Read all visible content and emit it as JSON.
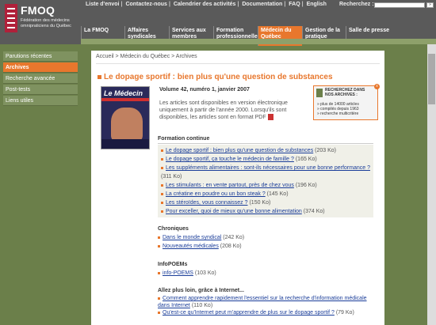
{
  "header": {
    "logo_text": "FMOQ",
    "logo_sub": "Fédération des médecins omnipraticiens du Québec",
    "top_links": [
      "Liste d'envoi",
      "Contactez-nous",
      "Calendrier des activités",
      "Documentation",
      "FAQ",
      "English"
    ],
    "search_label": "Recherchez :",
    "search_value": "",
    "search_go": "»"
  },
  "nav": {
    "items": [
      {
        "label": "La FMOQ",
        "active": false
      },
      {
        "label": "Affaires syndicales",
        "active": false
      },
      {
        "label": "Services aux membres",
        "active": false
      },
      {
        "label": "Formation professionnelle",
        "active": false
      },
      {
        "label": "Médecin du Québec",
        "active": true
      },
      {
        "label": "Gestion de la pratique",
        "active": false
      },
      {
        "label": "Salle de presse",
        "active": false
      }
    ]
  },
  "sidebar": {
    "items": [
      {
        "label": "Parutions récentes",
        "active": false
      },
      {
        "label": "Archives",
        "active": true
      },
      {
        "label": "Recherche avancée",
        "active": false
      },
      {
        "label": "Post-tests",
        "active": false
      },
      {
        "label": "Liens utiles",
        "active": false
      }
    ]
  },
  "breadcrumb": "Accueil > Médecin du Québec > Archives",
  "title": "Le dopage sportif : bien plus qu'une question de substances",
  "cover_title": "Le Médecin",
  "volume": "Volume 42, numéro 1, janvier 2007",
  "intro": "Les articles sont disponibles en version électronique uniquement à partir de l'année 2000. Lorsqu'ils sont disponibles, les articles sont en format PDF",
  "search_box": {
    "heading": "RECHERCHEZ DANS NOS ARCHIVES :",
    "close": "x",
    "points": [
      "» plus de 14000 articles",
      "» compilés depuis 1963",
      "» recherche multicritère"
    ]
  },
  "sections": {
    "formation": {
      "heading": "Formation continue",
      "items": [
        {
          "link": "Le dopage sportif : bien plus qu'une question de substances",
          "size": "(203 Ko)"
        },
        {
          "link": "Le dopage sportif, ça touche le médecin de famille ?",
          "size": "(165 Ko)"
        },
        {
          "link": "Les suppléments alimentaires : sont-ils nécessaires pour une bonne performance ?",
          "size": "(311 Ko)"
        },
        {
          "link": "Les stimulants : en vente partout, près de chez vous",
          "size": "(196 Ko)"
        },
        {
          "link": "La créatine en poudre ou un bon steak ?",
          "size": "(145 Ko)"
        },
        {
          "link": "Les stéroïdes, vous connaissez ?",
          "size": "(150 Ko)"
        },
        {
          "link": "Pour exceller, quoi de mieux qu'une bonne alimentation",
          "size": "(374 Ko)"
        }
      ]
    },
    "chroniques": {
      "heading": "Chroniques",
      "items": [
        {
          "link": "Dans le monde syndical",
          "size": "(242 Ko)"
        },
        {
          "link": "Nouveautés médicales",
          "size": "(208 Ko)"
        }
      ]
    },
    "infopoems": {
      "heading": "InfoPOEMs",
      "items": [
        {
          "link": "info-POEMS",
          "size": "(103 Ko)"
        }
      ]
    },
    "internet": {
      "heading": "Allez plus loin, grâce à Internet...",
      "items": [
        {
          "link": "Comment apprendre rapidement l'essentiel sur la recherche d'information médicale dans Internet",
          "size": "(110 Ko)"
        },
        {
          "link": "Qu'est-ce qu'Internet peut m'apprendre de plus sur le dopage sportif ?",
          "size": "(79 Ko)"
        }
      ]
    }
  }
}
